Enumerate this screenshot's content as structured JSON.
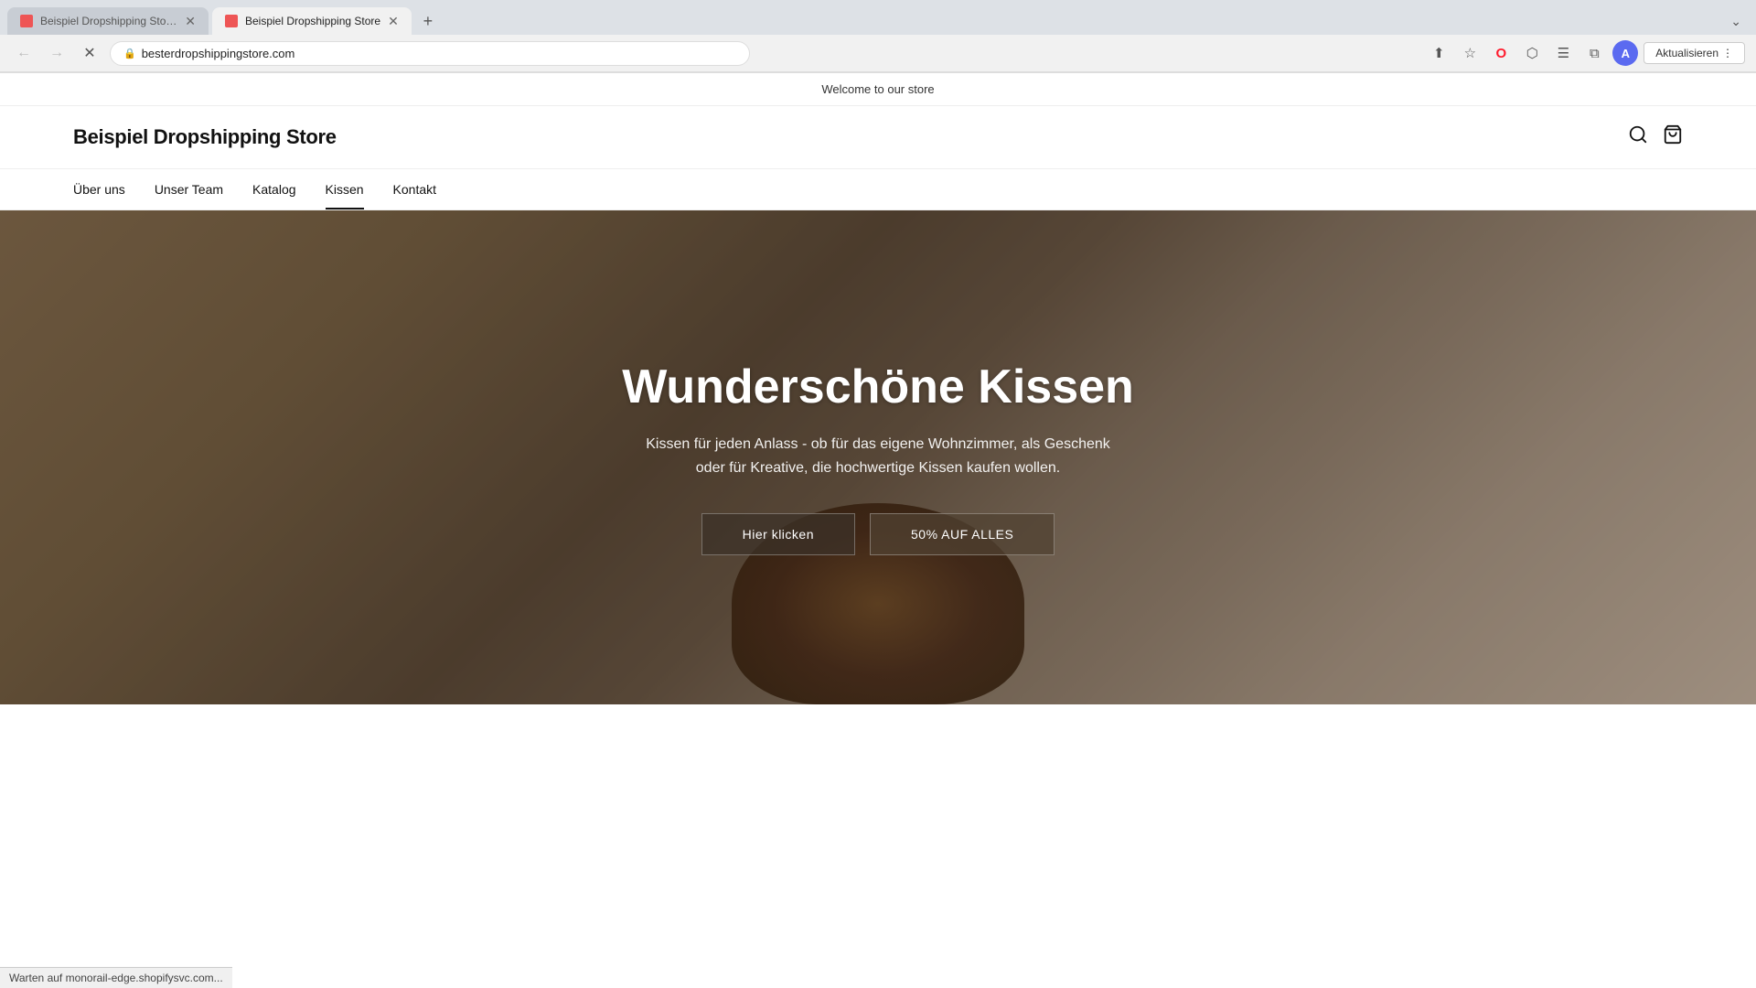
{
  "browser": {
    "tabs": [
      {
        "id": "tab1",
        "title": "Beispiel Dropshipping Store · ...",
        "active": false,
        "favicon_color": "#e88"
      },
      {
        "id": "tab2",
        "title": "Beispiel Dropshipping Store",
        "active": true,
        "favicon_color": "#e88"
      }
    ],
    "new_tab_label": "+",
    "tab_bar_chevron": "⌄",
    "url": "besterdropshippingstore.com",
    "back_btn": "←",
    "forward_btn": "→",
    "reload_btn": "✕",
    "share_icon": "⬆",
    "bookmark_icon": "☆",
    "opera_icon": "O",
    "extensions_icon": "⬡",
    "sidebar_icon": "☰",
    "split_icon": "⧉",
    "profile_initial": "A",
    "update_btn_label": "Aktualisieren",
    "update_btn_more": "⋮"
  },
  "store": {
    "announcement": "Welcome to our store",
    "logo": "Beispiel Dropshipping Store",
    "nav": [
      {
        "label": "Über uns",
        "active": false
      },
      {
        "label": "Unser Team",
        "active": false
      },
      {
        "label": "Katalog",
        "active": false
      },
      {
        "label": "Kissen",
        "active": true
      },
      {
        "label": "Kontakt",
        "active": false
      }
    ],
    "hero": {
      "title": "Wunderschöne Kissen",
      "subtitle": "Kissen für jeden Anlass - ob für das eigene Wohnzimmer, als Geschenk oder für Kreative, die hochwertige Kissen kaufen wollen.",
      "btn_primary": "Hier klicken",
      "btn_secondary": "50% AUF ALLES"
    }
  },
  "status_bar": {
    "text": "Warten auf monorail-edge.shopifysvc.com..."
  }
}
